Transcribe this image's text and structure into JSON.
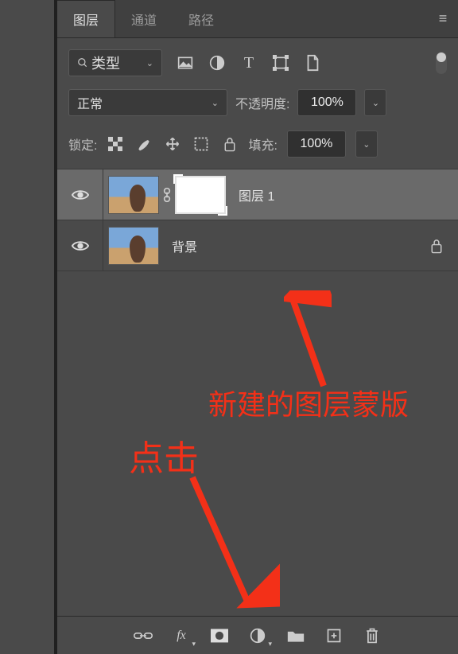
{
  "tabs": {
    "layers": "图层",
    "channels": "通道",
    "paths": "路径"
  },
  "filter_dropdown": {
    "prefix_icon": "search-icon",
    "label": "类型"
  },
  "icon_row": [
    "image-filter-icon",
    "adjustment-filter-icon",
    "text-filter-icon",
    "shape-filter-icon",
    "smartobject-filter-icon"
  ],
  "blend": {
    "mode": "正常",
    "opacity_label": "不透明度:",
    "opacity_value": "100%"
  },
  "lock": {
    "label": "锁定:",
    "icons": [
      "lock-pixels-icon",
      "lock-brush-icon",
      "lock-move-icon",
      "lock-artboard-icon",
      "lock-all-icon"
    ],
    "fill_label": "填充:",
    "fill_value": "100%"
  },
  "layers": [
    {
      "name": "图层 1",
      "has_mask": true,
      "selected": true,
      "locked": false
    },
    {
      "name": "背景",
      "has_mask": false,
      "selected": false,
      "locked": true
    }
  ],
  "bottom_icons": [
    "link-layers-icon",
    "fx-icon",
    "add-mask-icon",
    "adjustment-layer-icon",
    "group-icon",
    "new-layer-icon",
    "delete-icon"
  ],
  "annotations": {
    "mask_label": "新建的图层蒙版",
    "click_label": "点击"
  }
}
